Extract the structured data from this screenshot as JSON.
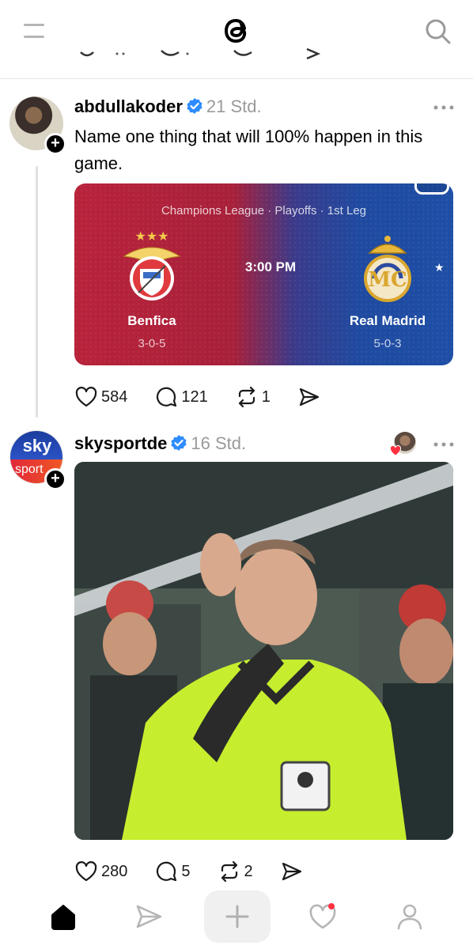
{
  "icons": {
    "menu": "menu-icon",
    "logo": "threads-logo-icon",
    "search": "search-icon",
    "verified": "verified-badge-icon",
    "more": "more-dots-icon",
    "like": "heart-icon",
    "reply": "comment-icon",
    "repost": "repost-icon",
    "share": "send-icon",
    "follow": "plus-icon"
  },
  "colors": {
    "verified": "#2f8cff",
    "notification_dot": "#ff3040",
    "card_left": "#b8233a",
    "card_right": "#1e4ea6"
  },
  "posts": [
    {
      "username": "abdullakoder",
      "time": "21 Std.",
      "text": "Name one thing that will 100% happen in this game.",
      "game_card": {
        "league": "Champions League · Playoffs · 1st Leg",
        "kickoff": "3:00 PM",
        "home": {
          "name": "Benfica",
          "record": "3-0-5"
        },
        "away": {
          "name": "Real Madrid",
          "record": "5-0-3"
        }
      },
      "stats": {
        "likes": "584",
        "replies": "121",
        "reposts": "1"
      }
    },
    {
      "username": "skysportde",
      "avatar_text_top": "sky",
      "avatar_text_bottom": "sport",
      "time": "16 Std.",
      "stats": {
        "likes": "280",
        "replies": "5",
        "reposts": "2"
      }
    }
  ],
  "nav": {
    "items": [
      "home",
      "send",
      "new-thread",
      "activity",
      "profile"
    ],
    "active": "home",
    "activity_has_notification": true
  }
}
